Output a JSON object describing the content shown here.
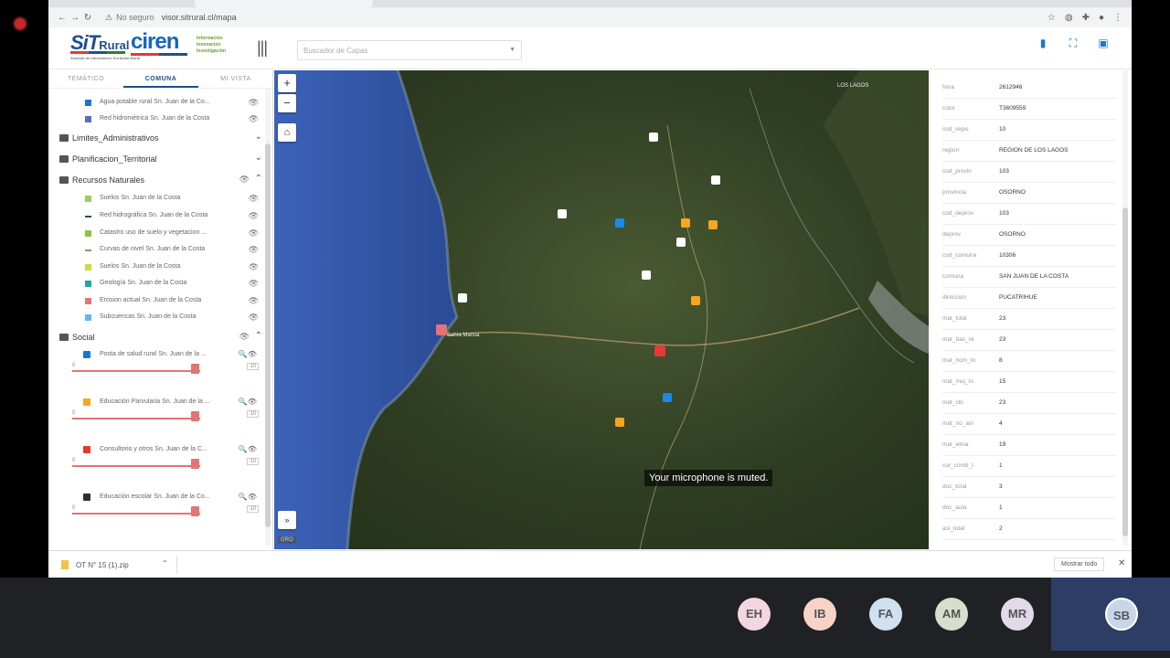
{
  "browser": {
    "security_label": "No seguro",
    "url": "visor.sitrural.cl/mapa"
  },
  "app": {
    "logo_main": "SiT",
    "logo_main_suffix": "Rural",
    "logo_main_sub": "Sistema de Información Territorial Rural",
    "logo_ciren": "ciren",
    "logo_ciren_tag": [
      "Información",
      "Innovación",
      "Investigación"
    ],
    "layer_search_placeholder": "Buscador de Capas"
  },
  "sidebar": {
    "tabs": [
      "TEMÁTICO",
      "COMUNA",
      "MI VISTA"
    ],
    "active_tab": "COMUNA",
    "top_layers": [
      {
        "label": "Agua potable rural Sn. Juan de la Co...",
        "color": "#1976d2"
      },
      {
        "label": "Red hidrométrica Sn. Juan de la Costa",
        "color": "#5c6bc0"
      }
    ],
    "groups": {
      "limites": "Limites_Administrativos",
      "planificacion": "Planificacion_Territorial",
      "recursos": "Recursos Naturales",
      "social": "Social"
    },
    "recursos_layers": [
      {
        "label": "Suelos Sn. Juan de la Costa",
        "color": "#9ccc65"
      },
      {
        "label": "Red hidrográfica Sn. Juan de la Costa",
        "color": "#37474f"
      },
      {
        "label": "Catastro uso de suelo y vegetacion ...",
        "color": "#8bc34a"
      },
      {
        "label": "Curvas de nivel Sn. Juan de la Costa",
        "color": "#a1887f"
      },
      {
        "label": "Suelos Sn. Juan de la Costa",
        "color": "#cddc39"
      },
      {
        "label": "Geología Sn. Juan de la Costa",
        "color": "#26a69a"
      },
      {
        "label": "Erosion actual Sn. Juan de la Costa",
        "color": "#e57373"
      },
      {
        "label": "Subcuencas Sn. Juan de la Costa",
        "color": "#64b5f6"
      }
    ],
    "social_layers": [
      {
        "label": "Posta de salud rural Sn. Juan de la ...",
        "color": "#1976d2",
        "min": "0",
        "max": "10"
      },
      {
        "label": "Educación Parvularia Sn. Juan de la ...",
        "color": "#f5a623",
        "min": "0",
        "max": "10"
      },
      {
        "label": "Consultorio y otros Sn. Juan de la C...",
        "color": "#e53935",
        "min": "0",
        "max": "10"
      },
      {
        "label": "Educación escolar Sn. Juan de la Co...",
        "color": "#263238",
        "min": "0",
        "max": "10"
      }
    ]
  },
  "map": {
    "zoom_in": "+",
    "zoom_out": "−",
    "places": {
      "bahia": "Bahía Mansa",
      "lagos": "LOS LAGOS"
    },
    "attribution": "GRO",
    "toast": "Your microphone is muted."
  },
  "info_panel": {
    "rows": [
      {
        "key": "hora",
        "value": "2612946"
      },
      {
        "key": "color",
        "value": "T3609559"
      },
      {
        "key": "cod_regio",
        "value": "10"
      },
      {
        "key": "region",
        "value": "REGION DE LOS LAGOS"
      },
      {
        "key": "cod_provin",
        "value": "103"
      },
      {
        "key": "provincia",
        "value": "OSORNO"
      },
      {
        "key": "cod_deprov",
        "value": "103"
      },
      {
        "key": "deprov",
        "value": "OSORNO"
      },
      {
        "key": "cod_comuna",
        "value": "10306"
      },
      {
        "key": "comuna",
        "value": "SAN JUAN DE LA COSTA"
      },
      {
        "key": "direccion",
        "value": "PUCATRIHUE"
      },
      {
        "key": "mat_total",
        "value": "23"
      },
      {
        "key": "mat_bas_re",
        "value": "23"
      },
      {
        "key": "mat_hom_to",
        "value": "8"
      },
      {
        "key": "mat_muj_to",
        "value": "15"
      },
      {
        "key": "mat_cbi",
        "value": "23"
      },
      {
        "key": "mat_no_ain",
        "value": "4"
      },
      {
        "key": "mat_etnia",
        "value": "19"
      },
      {
        "key": "cur_comb_t",
        "value": "1"
      },
      {
        "key": "doc_total",
        "value": "3"
      },
      {
        "key": "doc_aula",
        "value": "1"
      },
      {
        "key": "asi_total",
        "value": "2"
      }
    ]
  },
  "download_bar": {
    "file_name": "OT N° 15 (1).zip",
    "show_all": "Mostrar todo"
  },
  "meeting": {
    "participants": [
      {
        "initials": "EH",
        "color": "#f3d6e0"
      },
      {
        "initials": "IB",
        "color": "#f6d3c6"
      },
      {
        "initials": "FA",
        "color": "#cfe0ee"
      },
      {
        "initials": "AM",
        "color": "#d5dfcc"
      },
      {
        "initials": "MR",
        "color": "#e2dae9"
      }
    ],
    "self": {
      "initials": "SB",
      "color": "#c9d6ea"
    }
  }
}
